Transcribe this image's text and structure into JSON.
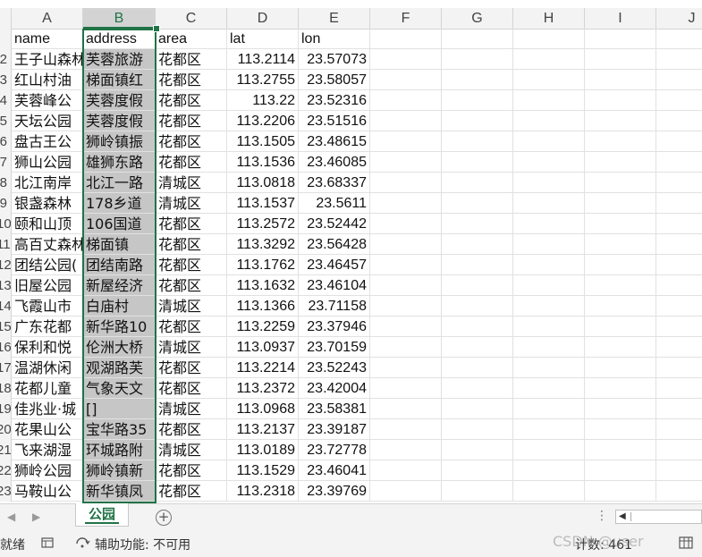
{
  "columns": [
    "A",
    "B",
    "C",
    "D",
    "E",
    "F",
    "G",
    "H",
    "I",
    "J"
  ],
  "selected_column": "B",
  "header_row": {
    "name": "name",
    "address": "address",
    "area": "area",
    "lat": "lat",
    "lon": "lon"
  },
  "row_labels": [
    "2",
    "3",
    "4",
    "5",
    "6",
    "7",
    "8",
    "9",
    "10",
    "11",
    "12",
    "13",
    "14",
    "15",
    "16",
    "17",
    "18",
    "19",
    "20",
    "21",
    "22",
    "23"
  ],
  "rows": [
    {
      "name": "王子山森林",
      "address": "芙蓉旅游",
      "area": "花都区",
      "lat": "113.2114",
      "lon": "23.57073"
    },
    {
      "name": "红山村油",
      "address": "梯面镇红",
      "area": "花都区",
      "lat": "113.2755",
      "lon": "23.58057"
    },
    {
      "name": "芙蓉峰公",
      "address": "芙蓉度假",
      "area": "花都区",
      "lat": "113.22",
      "lon": "23.52316"
    },
    {
      "name": "天坛公园",
      "address": "芙蓉度假",
      "area": "花都区",
      "lat": "113.2206",
      "lon": "23.51516"
    },
    {
      "name": "盘古王公",
      "address": "狮岭镇振",
      "area": "花都区",
      "lat": "113.1505",
      "lon": "23.48615"
    },
    {
      "name": "狮山公园",
      "address": "雄狮东路",
      "area": "花都区",
      "lat": "113.1536",
      "lon": "23.46085"
    },
    {
      "name": "北江南岸",
      "address": "北江一路",
      "area": "清城区",
      "lat": "113.0818",
      "lon": "23.68337"
    },
    {
      "name": "银盏森林",
      "address": "178乡道",
      "area": "清城区",
      "lat": "113.1537",
      "lon": "23.5611"
    },
    {
      "name": "颐和山顶",
      "address": "106国道",
      "area": "花都区",
      "lat": "113.2572",
      "lon": "23.52442"
    },
    {
      "name": "高百丈森林",
      "address": "梯面镇",
      "area": "花都区",
      "lat": "113.3292",
      "lon": "23.56428"
    },
    {
      "name": "团结公园(",
      "address": "团结南路",
      "area": "花都区",
      "lat": "113.1762",
      "lon": "23.46457"
    },
    {
      "name": "旧屋公园",
      "address": "新屋经济",
      "area": "花都区",
      "lat": "113.1632",
      "lon": "23.46104"
    },
    {
      "name": "飞霞山市",
      "address": "白庙村",
      "area": "清城区",
      "lat": "113.1366",
      "lon": "23.71158"
    },
    {
      "name": "广东花都",
      "address": "新华路10",
      "area": "花都区",
      "lat": "113.2259",
      "lon": "23.37946"
    },
    {
      "name": "保利和悦",
      "address": "伦洲大桥",
      "area": "清城区",
      "lat": "113.0937",
      "lon": "23.70159"
    },
    {
      "name": "温湖休闲",
      "address": "观湖路芙",
      "area": "花都区",
      "lat": "113.2214",
      "lon": "23.52243"
    },
    {
      "name": "花都儿童",
      "address": "气象天文",
      "area": "花都区",
      "lat": "113.2372",
      "lon": "23.42004"
    },
    {
      "name": "佳兆业·城",
      "address": "[]",
      "area": "清城区",
      "lat": "113.0968",
      "lon": "23.58381"
    },
    {
      "name": "花果山公",
      "address": "宝华路35",
      "area": "花都区",
      "lat": "113.2137",
      "lon": "23.39187"
    },
    {
      "name": "飞来湖湿",
      "address": "环城路附",
      "area": "清城区",
      "lat": "113.0189",
      "lon": "23.72778"
    },
    {
      "name": "狮岭公园",
      "address": "狮岭镇新",
      "area": "花都区",
      "lat": "113.1529",
      "lon": "23.46041"
    },
    {
      "name": "马鞍山公",
      "address": "新华镇凤",
      "area": "花都区",
      "lat": "113.2318",
      "lon": "23.39769"
    }
  ],
  "sheet_tab": "公园",
  "status": {
    "ready": "就绪",
    "accessibility": "辅助功能: 不可用",
    "count": "计数: 461",
    "watermark": "CSDN @user"
  },
  "colors": {
    "accent": "#217346",
    "selected_fill": "#c6c6c6",
    "header_bg": "#f3f3f3"
  }
}
